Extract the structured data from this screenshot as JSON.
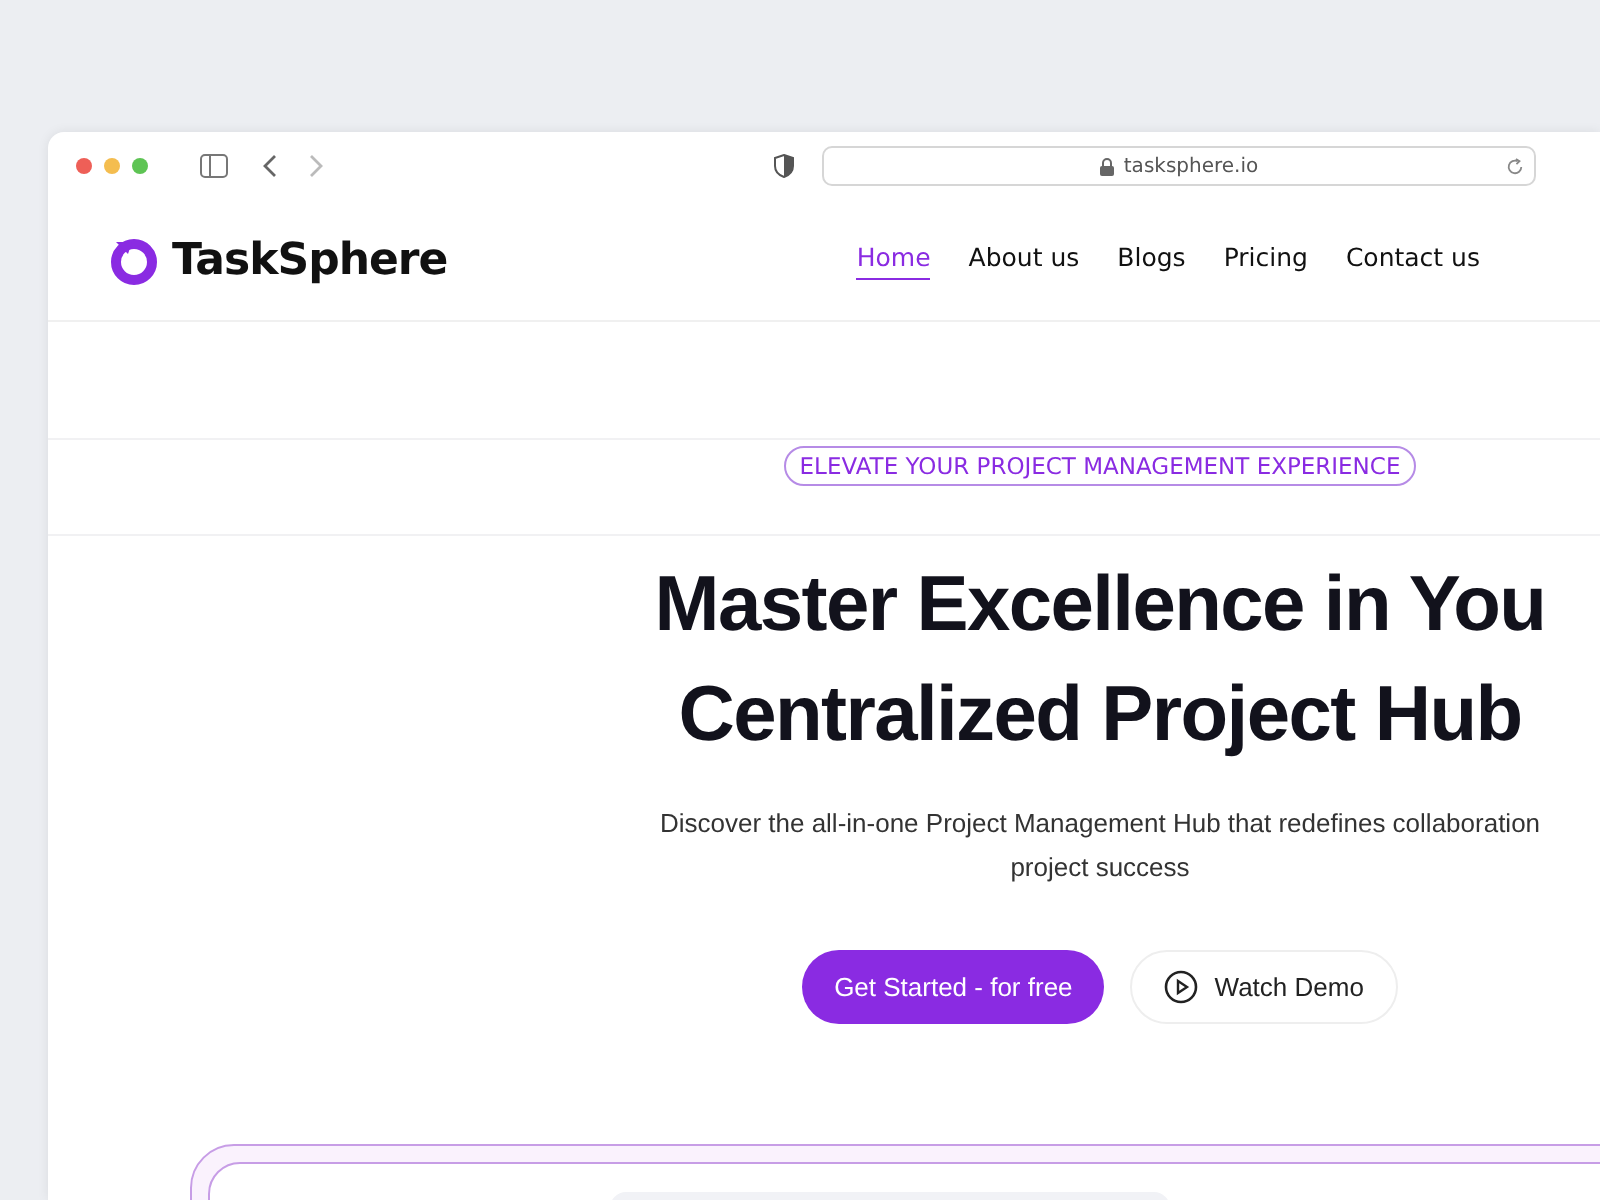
{
  "browser": {
    "url": "tasksphere.io"
  },
  "site": {
    "logo": "TaskSphere",
    "nav": [
      {
        "label": "Home",
        "selected": true
      },
      {
        "label": "About us",
        "selected": false
      },
      {
        "label": "Blogs",
        "selected": false
      },
      {
        "label": "Pricing",
        "selected": false
      },
      {
        "label": "Contact us",
        "selected": false
      }
    ]
  },
  "hero": {
    "badge": "ELEVATE YOUR PROJECT MANAGEMENT EXPERIENCE",
    "headline": [
      "Master Excellence in You",
      "Centralized Project Hub"
    ],
    "subtitle": [
      "Discover the all-in-one Project Management Hub that redefines collaboration",
      "project success"
    ],
    "buttons": [
      {
        "kind": "primary",
        "label": "Get Started - for free"
      },
      {
        "kind": "play",
        "label": "Watch Demo"
      }
    ]
  }
}
